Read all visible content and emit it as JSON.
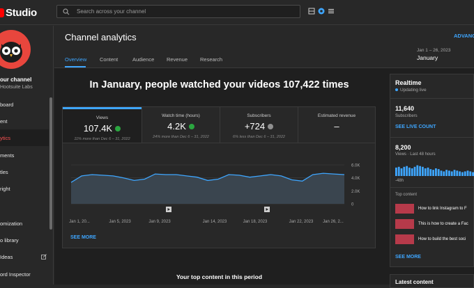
{
  "topbar": {
    "logo_text": "Studio",
    "search_placeholder": "Search across your channel"
  },
  "sidebar": {
    "channel_title": "our channel",
    "channel_name": "Hootsuite Labs",
    "items": [
      {
        "label": "board"
      },
      {
        "label": "ent"
      },
      {
        "label": "ytics",
        "active": true
      },
      {
        "label": "ments"
      },
      {
        "label": "tles"
      },
      {
        "label": "right"
      },
      {
        "label": "omization"
      },
      {
        "label": "o library"
      },
      {
        "label": "Ideas"
      },
      {
        "label": "ord Inspector"
      }
    ]
  },
  "header": {
    "title": "Channel analytics",
    "advanced_label": "ADVANC",
    "tabs": [
      {
        "label": "Overview",
        "active": true
      },
      {
        "label": "Content"
      },
      {
        "label": "Audience"
      },
      {
        "label": "Revenue"
      },
      {
        "label": "Research"
      }
    ],
    "date_range": "Jan 1 – 26, 2023",
    "date_label": "January"
  },
  "overview": {
    "headline": "In January, people watched your videos 107,422 times",
    "metrics": [
      {
        "label": "Views",
        "value": "107.4K",
        "badge": "up",
        "sub": "11% more than Dec 6 – 31, 2022"
      },
      {
        "label": "Watch time (hours)",
        "value": "4.2K",
        "badge": "up",
        "sub": "24% more than Dec 6 – 31, 2022"
      },
      {
        "label": "Subscribers",
        "value": "+724",
        "badge": "down",
        "sub": "6% less than Dec 6 – 31, 2022"
      },
      {
        "label": "Estimated revenue",
        "value": "–",
        "badge": "",
        "sub": ""
      }
    ],
    "see_more": "SEE MORE",
    "top_content_title": "Your top content in this period"
  },
  "chart_data": {
    "type": "area",
    "x_labels": [
      "Jan 1, 20...",
      "Jan 5, 2023",
      "Jan 9, 2023",
      "Jan 14, 2023",
      "Jan 18, 2023",
      "Jan 22, 2023",
      "Jan 26, 2..."
    ],
    "y_ticks": [
      "6.0K",
      "4.0K",
      "2.0K",
      "0"
    ],
    "ylim": [
      0,
      6000
    ],
    "series": [
      {
        "values": [
          3300,
          4300,
          4500,
          4400,
          4300,
          4000,
          3600,
          3800,
          4600,
          4500,
          4500,
          4300,
          4100,
          3600,
          3800,
          4500,
          4400,
          4100,
          4300,
          4500,
          4300,
          3700,
          3500,
          4500,
          4700,
          4600,
          4500
        ]
      }
    ],
    "grid": true,
    "color": "#3ea6ff",
    "fill": "#3a454f"
  },
  "realtime": {
    "title": "Realtime",
    "updating": "Updating live",
    "subs_value": "11,640",
    "subs_label": "Subscribers",
    "see_live": "SEE LIVE COUNT",
    "views_value": "8,200",
    "views_label": "Views · Last 48 hours",
    "bar_label_left": "-48h",
    "bars": [
      0.55,
      0.6,
      0.5,
      0.6,
      0.65,
      0.55,
      0.5,
      0.6,
      0.7,
      0.65,
      0.6,
      0.5,
      0.55,
      0.45,
      0.4,
      0.5,
      0.45,
      0.35,
      0.3,
      0.4,
      0.35,
      0.3,
      0.4,
      0.35,
      0.3,
      0.25,
      0.3,
      0.35,
      0.3,
      0.25
    ],
    "top_content_label": "Top content",
    "videos": [
      {
        "title": "How to link Instagram to F"
      },
      {
        "title": "This is how to create a Fac"
      },
      {
        "title": "How to build the best soci"
      }
    ],
    "see_more": "SEE MORE"
  },
  "latest": {
    "title": "Latest content"
  }
}
